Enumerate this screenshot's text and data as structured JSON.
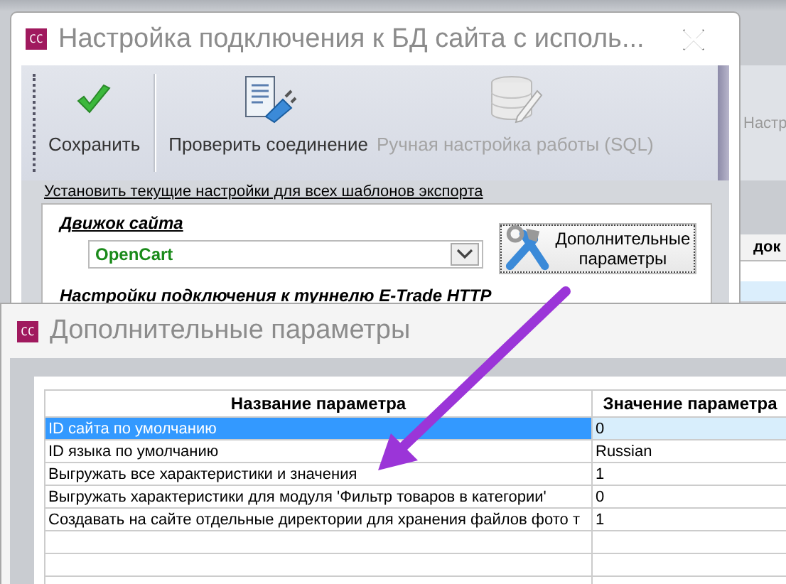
{
  "background_app": {
    "toolbar_label": "Настр",
    "column_header": "док"
  },
  "main_window": {
    "icon_text": "CC",
    "title": "Настройка подключения к БД сайта с исполь...",
    "toolbar": [
      {
        "kind": "save",
        "label": "Сохранить",
        "disabled": false
      },
      {
        "kind": "check",
        "label": "Проверить соединение",
        "disabled": false
      },
      {
        "kind": "sql",
        "label": "Ручная настройка работы (SQL)",
        "disabled": true
      }
    ],
    "apply_link": "Установить текущие настройки для всех шаблонов экспорта",
    "engine_label": "Движок сайта",
    "engine_value": "OpenCart",
    "extra_button": "Дополнительные параметры",
    "tunnel_label": "Настройки подключения к туннелю E-Trade HTTP"
  },
  "params_window": {
    "icon_text": "CC",
    "title": "Дополнительные параметры",
    "table": {
      "columns": [
        "Название параметра",
        "Значение параметра"
      ],
      "rows": [
        {
          "name": "ID сайта по умолчанию",
          "value": "0",
          "selected": true
        },
        {
          "name": "ID языка по умолчанию",
          "value": "Russian",
          "selected": false
        },
        {
          "name": "Выгружать все характеристики и значения",
          "value": "1",
          "selected": false
        },
        {
          "name": "Выгружать характеристики для модуля 'Фильтр товаров в категории'",
          "value": "0",
          "selected": false
        },
        {
          "name": "Создавать на сайте отдельные директории для хранения файлов фото т",
          "value": "1",
          "selected": false
        }
      ]
    }
  }
}
